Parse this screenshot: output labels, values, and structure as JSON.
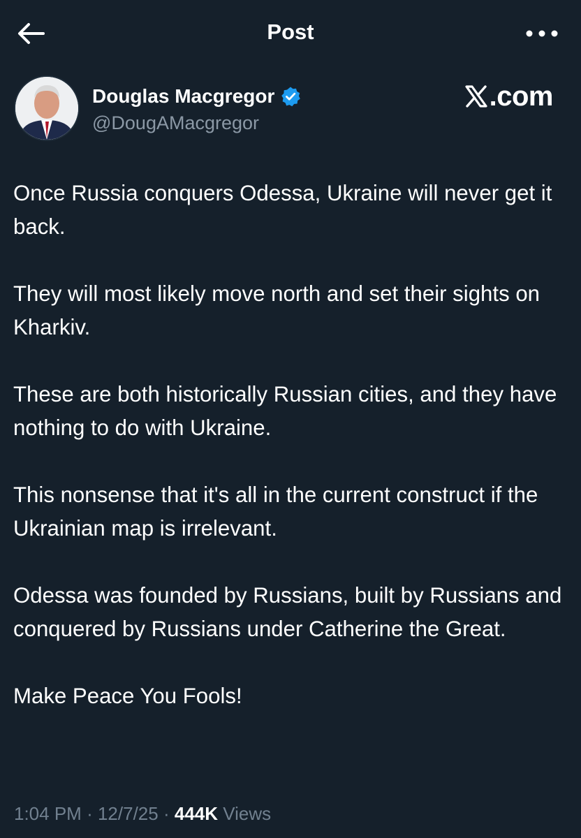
{
  "header": {
    "title": "Post",
    "back_icon": "arrow-left-icon",
    "more_icon": "more-horizontal-icon"
  },
  "author": {
    "name": "Douglas Macgregor",
    "handle": "@DougAMacgregor",
    "verified": true,
    "verified_color": "#1d9bf0"
  },
  "watermark": {
    "text": ".com",
    "icon": "x-logo-icon"
  },
  "tweet": {
    "paragraphs": [
      "Once Russia conquers Odessa, Ukraine will never get it back.",
      "They will most likely move north and set their sights on Kharkiv.",
      "These are both historically Russian cities, and they have nothing to do with Ukraine.",
      "This nonsense that it's all in the current construct if the Ukrainian map is irrelevant.",
      "Odessa was founded by Russians, built by Russians and conquered by Russians under Catherine the Great.",
      "Make Peace You Fools!"
    ]
  },
  "meta": {
    "time": "1:04 PM",
    "separator": "·",
    "date": "12/7/25",
    "views_count": "444K",
    "views_label": "Views"
  },
  "colors": {
    "background": "#15202b",
    "text": "#ffffff",
    "secondary_text": "#8b98a5",
    "accent": "#1d9bf0"
  }
}
